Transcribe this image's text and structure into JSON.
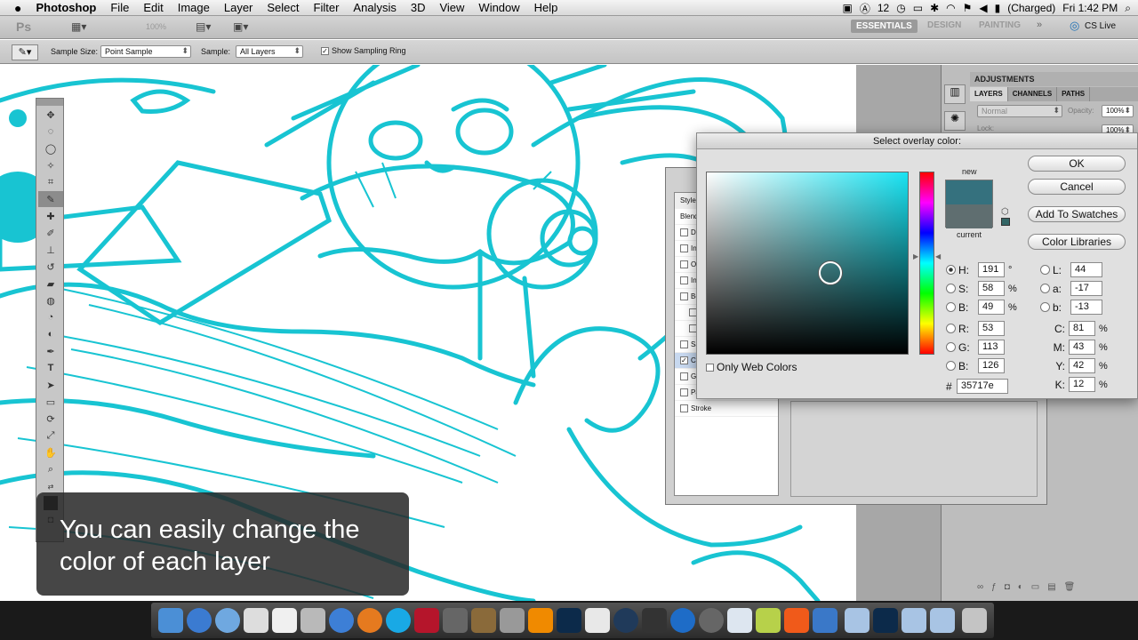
{
  "menubar": {
    "apple": "",
    "app_name": "Photoshop",
    "items": [
      "File",
      "Edit",
      "Image",
      "Layer",
      "Select",
      "Filter",
      "Analysis",
      "3D",
      "View",
      "Window",
      "Help"
    ],
    "status_number": "12",
    "battery": "(Charged)",
    "clock": "Fri 1:42 PM"
  },
  "appbar": {
    "ps_logo": "Ps",
    "zoom": "100%",
    "workspaces": [
      "ESSENTIALS",
      "DESIGN",
      "PAINTING"
    ],
    "cs_live": "CS Live"
  },
  "optionsbar": {
    "sample_size_label": "Sample Size:",
    "sample_size_value": "Point Sample",
    "sample_label": "Sample:",
    "sample_value": "All Layers",
    "show_ring_label": "Show Sampling Ring"
  },
  "caption": {
    "line1": "You can easily change the",
    "line2": "color of each layer"
  },
  "panels": {
    "adjustments": "ADJUSTMENTS",
    "tabs": [
      "LAYERS",
      "CHANNELS",
      "PATHS"
    ],
    "blend_mode": "Normal",
    "opacity_label": "Opacity:",
    "opacity_value": "100%",
    "lock_label": "Lock:",
    "fill_value": "100%"
  },
  "styles_dialog": {
    "items": [
      "Styles",
      "Blend",
      "D",
      "In",
      "O",
      "In",
      "Be",
      "",
      "",
      "Sa",
      "C",
      "G",
      "Pa",
      "Stroke"
    ]
  },
  "picker": {
    "title": "Select overlay color:",
    "new_label": "new",
    "current_label": "current",
    "new_color": "#35717e",
    "current_color": "#5f6e70",
    "buttons": {
      "ok": "OK",
      "cancel": "Cancel",
      "add_swatches": "Add To Swatches",
      "libraries": "Color Libraries"
    },
    "only_web": "Only Web Colors",
    "hsb": {
      "h_label": "H:",
      "h": "191",
      "h_unit": "°",
      "s_label": "S:",
      "s": "58",
      "s_unit": "%",
      "b_label": "B:",
      "b": "49",
      "b_unit": "%"
    },
    "rgb": {
      "r_label": "R:",
      "r": "53",
      "g_label": "G:",
      "g": "113",
      "b_label": "B:",
      "b": "126"
    },
    "lab": {
      "l_label": "L:",
      "l": "44",
      "a_label": "a:",
      "a": "-17",
      "b_label": "b:",
      "b": "-13"
    },
    "cmyk": {
      "c_label": "C:",
      "c": "81",
      "m_label": "M:",
      "m": "43",
      "y_label": "Y:",
      "y": "42",
      "k_label": "K:",
      "k": "12",
      "unit": "%"
    },
    "hex_label": "#",
    "hex": "35717e"
  }
}
